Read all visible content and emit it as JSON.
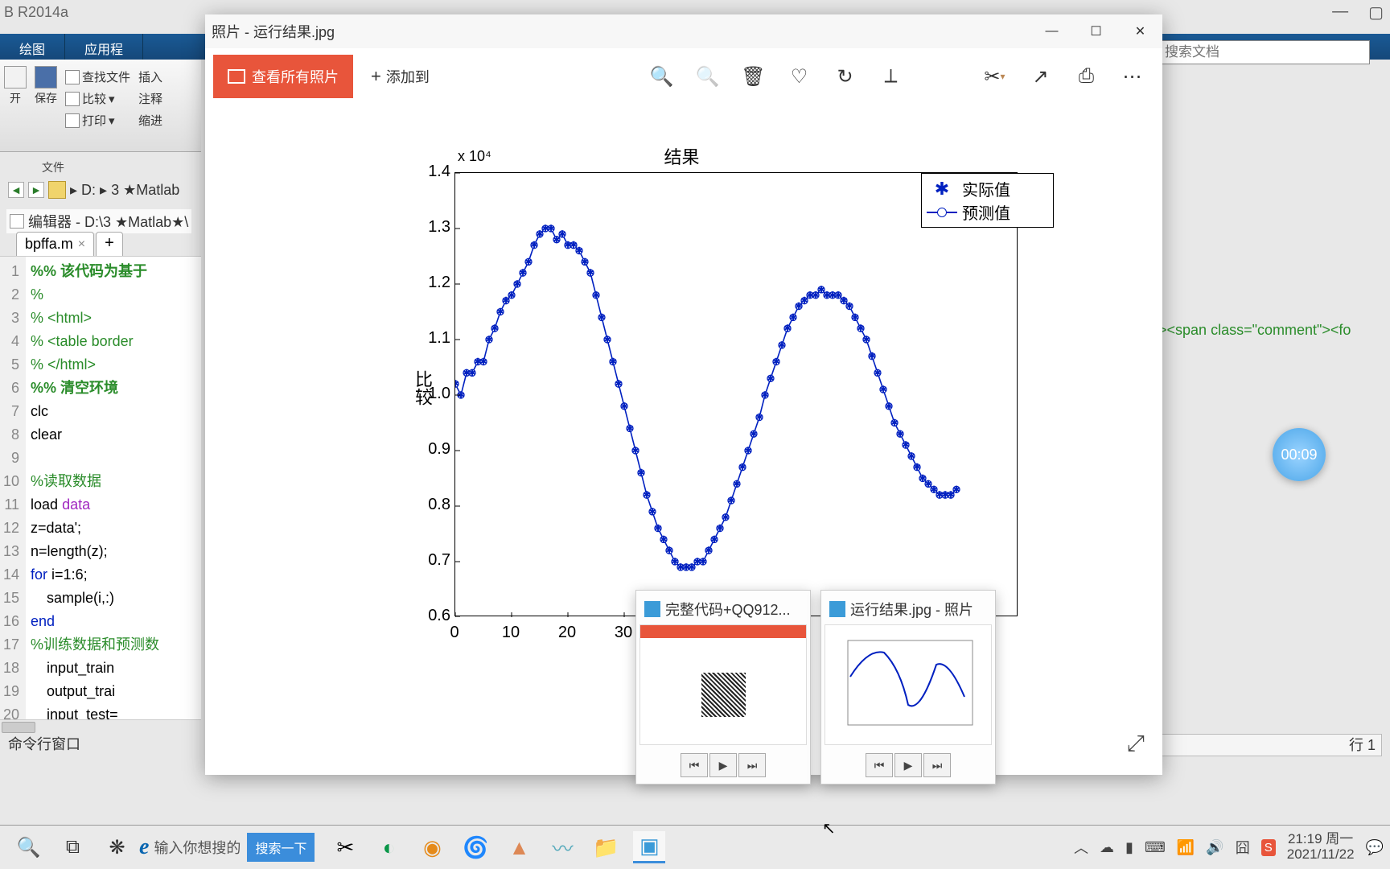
{
  "matlab": {
    "title": "B R2014a",
    "tabs": [
      "绘图",
      "应用程"
    ],
    "toolbar": {
      "open": "开",
      "save": "保存",
      "find_files": "查找文件",
      "compare": "比较",
      "print": "打印",
      "insert": "插入",
      "comment": "注释",
      "indent": "缩进",
      "file_section": "文件"
    },
    "breadcrumb": [
      "D:",
      "3 ★Matlab"
    ],
    "editor_title": "编辑器 - D:\\3 ★Matlab★\\",
    "tab_file": "bpffa.m",
    "code_lines": [
      {
        "n": "1",
        "html": "<span class='sect'>%% 该代码为基于</span>"
      },
      {
        "n": "2",
        "html": "<span class='comment'>%</span>"
      },
      {
        "n": "3",
        "html": "<span class='comment'>% &lt;html&gt;</span>"
      },
      {
        "n": "4",
        "html": "<span class='comment'>% &lt;table border</span>"
      },
      {
        "n": "5",
        "html": "<span class='comment'>% &lt;/html&gt;</span>"
      },
      {
        "n": "6",
        "html": "<span class='sect'>%% 清空环境</span>"
      },
      {
        "n": "7",
        "html": "clc"
      },
      {
        "n": "8",
        "html": "clear"
      },
      {
        "n": "9",
        "html": ""
      },
      {
        "n": "10",
        "html": "<span class='comment'>%读取数据</span>"
      },
      {
        "n": "11",
        "html": "load <span class='str'>data</span>"
      },
      {
        "n": "12",
        "html": "z=data';"
      },
      {
        "n": "13",
        "html": "n=length(z);"
      },
      {
        "n": "14",
        "html": "<span class='kw'>for</span> i=1:6;"
      },
      {
        "n": "15",
        "html": "    sample(i,:)"
      },
      {
        "n": "16",
        "html": "<span class='kw'>end</span>"
      },
      {
        "n": "17",
        "html": "<span class='comment'>%训练数据和预测数</span>"
      },
      {
        "n": "18",
        "html": "    input_train"
      },
      {
        "n": "19",
        "html": "    output_trai"
      },
      {
        "n": "20",
        "html": "    input_test="
      }
    ],
    "cmd_window": "命令行窗口",
    "right_snippet": "d><span class=\"comment\"><fo",
    "status_line": "行 1",
    "search_placeholder": "搜索文档"
  },
  "photos": {
    "title": "照片 - 运行结果.jpg",
    "view_all": "查看所有照片",
    "add_to": "添加到",
    "resize_icon": "⤢"
  },
  "chart_data": {
    "type": "line",
    "title": "结果",
    "scale": "x 10⁴",
    "ylabel": "比较",
    "xlabel": "",
    "xticks": [
      0,
      10,
      20,
      30
    ],
    "yticks": [
      0.6,
      0.7,
      0.8,
      0.9,
      1.0,
      1.1,
      1.2,
      1.3,
      1.4
    ],
    "xlim": [
      0,
      100
    ],
    "ylim": [
      0.6,
      1.4
    ],
    "legend": [
      "实际值",
      "预测值"
    ],
    "series": [
      {
        "name": "实际值",
        "marker": "star",
        "values": [
          1.02,
          1.0,
          1.04,
          1.04,
          1.06,
          1.06,
          1.1,
          1.12,
          1.15,
          1.17,
          1.18,
          1.2,
          1.22,
          1.24,
          1.27,
          1.29,
          1.3,
          1.3,
          1.28,
          1.29,
          1.27,
          1.27,
          1.26,
          1.24,
          1.22,
          1.18,
          1.14,
          1.1,
          1.06,
          1.02,
          0.98,
          0.94,
          0.9,
          0.86,
          0.82,
          0.79,
          0.76,
          0.74,
          0.72,
          0.7,
          0.69,
          0.69,
          0.69,
          0.7,
          0.7,
          0.72,
          0.74,
          0.76,
          0.78,
          0.81,
          0.84,
          0.87,
          0.9,
          0.93,
          0.96,
          1.0,
          1.03,
          1.06,
          1.09,
          1.12,
          1.14,
          1.16,
          1.17,
          1.18,
          1.18,
          1.19,
          1.18,
          1.18,
          1.18,
          1.17,
          1.16,
          1.14,
          1.12,
          1.1,
          1.07,
          1.04,
          1.01,
          0.98,
          0.95,
          0.93,
          0.91,
          0.89,
          0.87,
          0.85,
          0.84,
          0.83,
          0.82,
          0.82,
          0.82,
          0.83
        ]
      },
      {
        "name": "预测值",
        "marker": "circle-line",
        "values": [
          1.02,
          1.0,
          1.04,
          1.04,
          1.06,
          1.06,
          1.1,
          1.12,
          1.15,
          1.17,
          1.18,
          1.2,
          1.22,
          1.24,
          1.27,
          1.29,
          1.3,
          1.3,
          1.28,
          1.29,
          1.27,
          1.27,
          1.26,
          1.24,
          1.22,
          1.18,
          1.14,
          1.1,
          1.06,
          1.02,
          0.98,
          0.94,
          0.9,
          0.86,
          0.82,
          0.79,
          0.76,
          0.74,
          0.72,
          0.7,
          0.69,
          0.69,
          0.69,
          0.7,
          0.7,
          0.72,
          0.74,
          0.76,
          0.78,
          0.81,
          0.84,
          0.87,
          0.9,
          0.93,
          0.96,
          1.0,
          1.03,
          1.06,
          1.09,
          1.12,
          1.14,
          1.16,
          1.17,
          1.18,
          1.18,
          1.19,
          1.18,
          1.18,
          1.18,
          1.17,
          1.16,
          1.14,
          1.12,
          1.1,
          1.07,
          1.04,
          1.01,
          0.98,
          0.95,
          0.93,
          0.91,
          0.89,
          0.87,
          0.85,
          0.84,
          0.83,
          0.82,
          0.82,
          0.82,
          0.83
        ]
      }
    ]
  },
  "thumbnails": [
    {
      "title": "完整代码+QQ912..."
    },
    {
      "title": "运行结果.jpg - 照片"
    }
  ],
  "timer": "00:09",
  "taskbar": {
    "search_text": "输入你想搜的",
    "search_btn": "搜索一下",
    "time": "21:19",
    "day": "周一",
    "date": "2021/11/22"
  }
}
